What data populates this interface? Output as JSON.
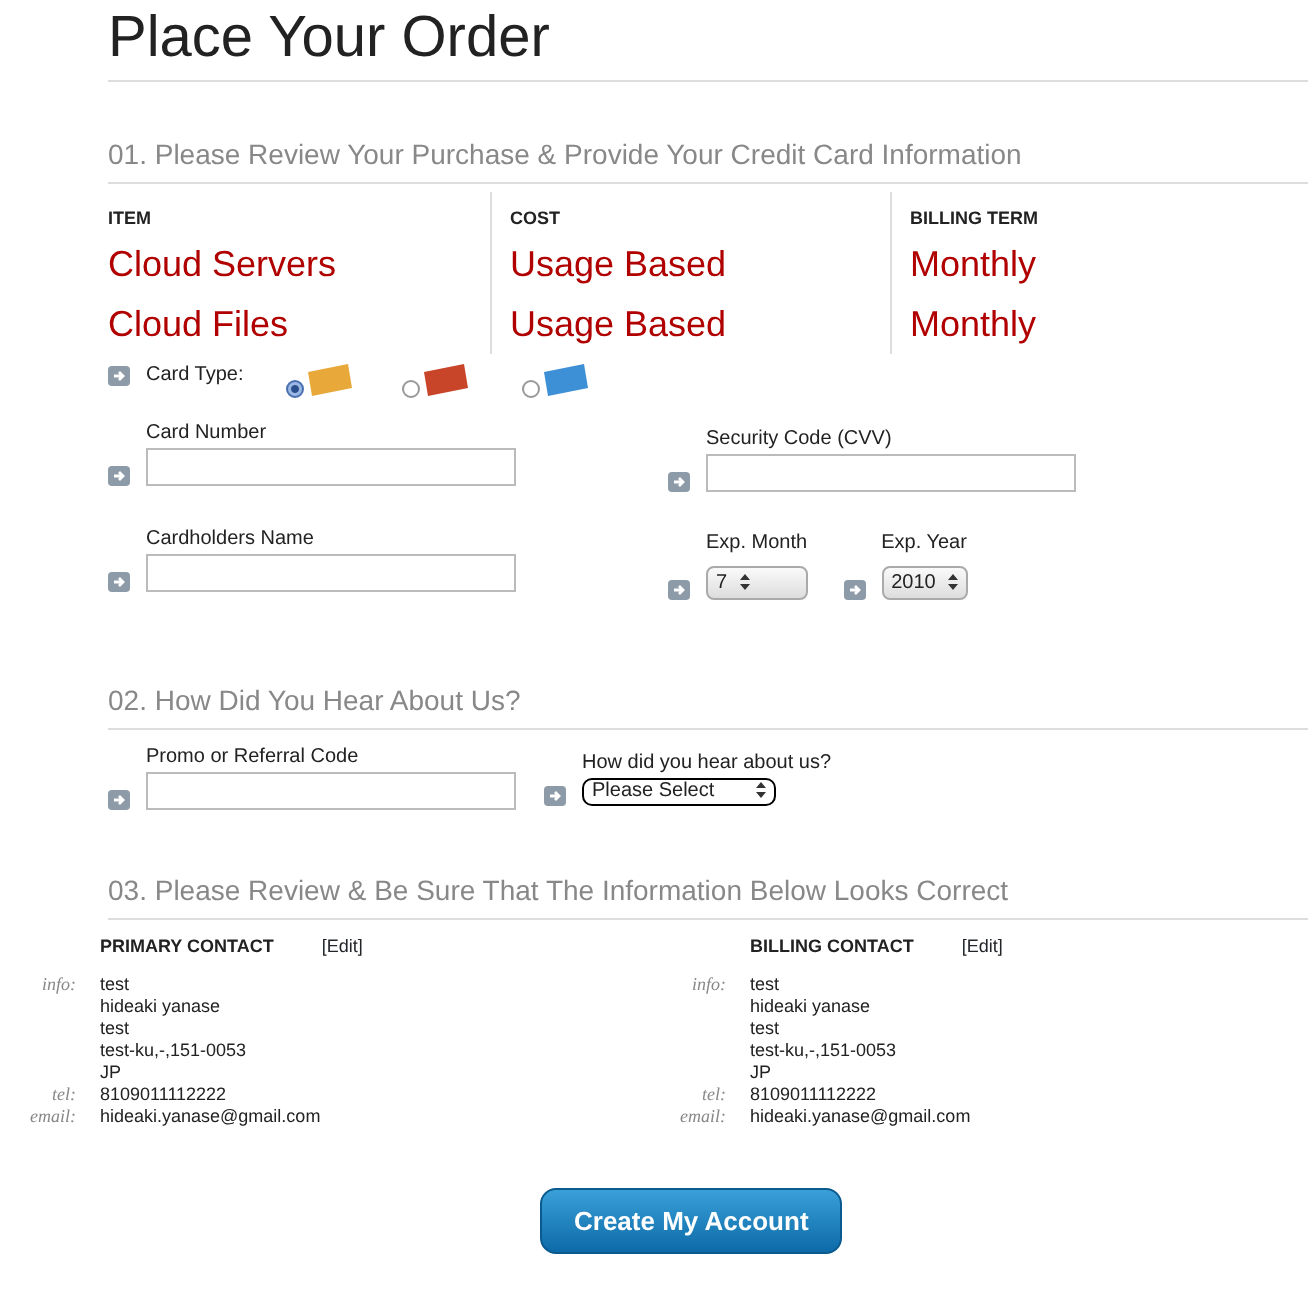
{
  "title": "Place Your Order",
  "section1": {
    "heading": "01. Please Review Your Purchase & Provide Your Credit Card Information",
    "columns": [
      "ITEM",
      "COST",
      "BILLING TERM"
    ],
    "rows": [
      [
        "Cloud Servers",
        "Usage Based",
        "Monthly"
      ],
      [
        "Cloud Files",
        "Usage Based",
        "Monthly"
      ]
    ],
    "card_type": {
      "label": "Card Type:",
      "options": [
        {
          "selected": true,
          "color": "#e8a93a"
        },
        {
          "selected": false,
          "color": "#c8452a"
        },
        {
          "selected": false,
          "color": "#3d8fd6"
        }
      ]
    },
    "card_number": {
      "label": "Card Number"
    },
    "security_code": {
      "label": "Security Code (CVV)"
    },
    "cardholder_name": {
      "label": "Cardholders Name"
    },
    "exp_month": {
      "label": "Exp. Month",
      "value": "7"
    },
    "exp_year": {
      "label": "Exp. Year",
      "value": "2010"
    }
  },
  "section2": {
    "heading": "02. How Did You Hear About Us?",
    "promo": {
      "label": "Promo or Referral Code"
    },
    "source": {
      "label": "How did you hear about us?",
      "value": "Please Select"
    }
  },
  "section3": {
    "heading": "03. Please Review & Be Sure That The Information Below Looks Correct",
    "contacts": [
      {
        "title": "PRIMARY CONTACT",
        "edit": "[Edit]",
        "info_label": "info:",
        "info": [
          "test",
          "hideaki yanase",
          "test",
          "test-ku,-,151-0053",
          "JP"
        ],
        "tel_label": "tel:",
        "tel": "8109011112222",
        "email_label": "email:",
        "email": "hideaki.yanase@gmail.com"
      },
      {
        "title": "BILLING CONTACT",
        "edit": "[Edit]",
        "info_label": "info:",
        "info": [
          "test",
          "hideaki yanase",
          "test",
          "test-ku,-,151-0053",
          "JP"
        ],
        "tel_label": "tel:",
        "tel": "8109011112222",
        "email_label": "email:",
        "email": "hideaki.yanase@gmail.com"
      }
    ]
  },
  "button": "Create My Account"
}
